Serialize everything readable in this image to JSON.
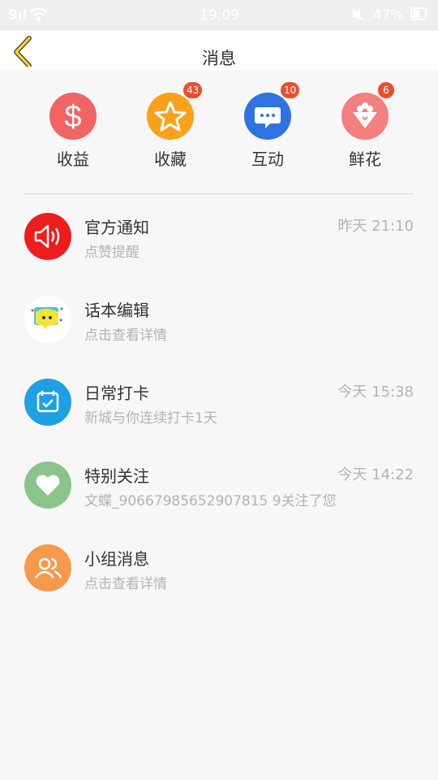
{
  "status_bar": {
    "signal": "9ıl",
    "time": "19:09",
    "battery": "47%"
  },
  "header": {
    "title": "消息",
    "back_icon": "chevron-left-icon"
  },
  "quick_actions": [
    {
      "label": "收益",
      "icon": "dollar-icon",
      "color": "#f06464",
      "badge": ""
    },
    {
      "label": "收藏",
      "icon": "star-icon",
      "color": "#f9a11b",
      "badge": "43"
    },
    {
      "label": "互动",
      "icon": "chat-bubble-icon",
      "color": "#2f73e0",
      "badge": "10"
    },
    {
      "label": "鲜花",
      "icon": "bouquet-icon",
      "color": "#f57f7f",
      "badge": "6"
    }
  ],
  "messages": [
    {
      "title": "官方通知",
      "subtitle": "点赞提醒",
      "time": "昨天 21:10",
      "icon": "speaker-icon",
      "color": "#ee1c1c"
    },
    {
      "title": "话本编辑",
      "subtitle": "点击查看详情",
      "time": "",
      "icon": "editor-avatar-icon",
      "color": "#ffffff"
    },
    {
      "title": "日常打卡",
      "subtitle": "新城与你连续打卡1天",
      "time": "今天 15:38",
      "icon": "calendar-check-icon",
      "color": "#1ea0e4"
    },
    {
      "title": "特别关注",
      "subtitle": "文蝶_90667985652907815 9关注了您",
      "time": "今天 14:22",
      "icon": "heart-icon",
      "color": "#8bc48b"
    },
    {
      "title": "小组消息",
      "subtitle": "点击查看详情",
      "time": "",
      "icon": "group-icon",
      "color": "#f59a4b"
    }
  ]
}
